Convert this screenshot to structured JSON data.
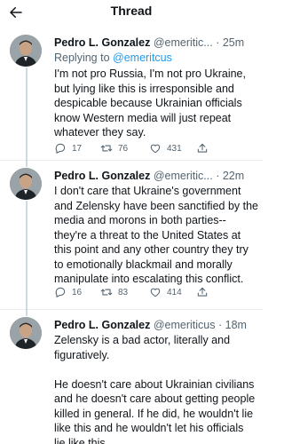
{
  "header": {
    "title": "Thread",
    "back_icon": "arrow-left-icon"
  },
  "colors": {
    "accent": "#1d9bf0",
    "secondary_text": "#536471",
    "divider": "#e6ecf0",
    "thread_line": "#cfd9de"
  },
  "tweets": [
    {
      "name": "Pedro L. Gonzalez",
      "handle": "@emeritic...",
      "time": "25m",
      "reply_prefix": "Replying to ",
      "reply_mention": "@emeritcus",
      "text": "I'm not pro Russia, I'm not pro Ukraine,\nbut lying like this is irresponsible and\ndespicable because Ukrainian officials\nknow Western media will just repeat\nwhatever they say.",
      "replies": "17",
      "retweets": "76",
      "likes": "431"
    },
    {
      "name": "Pedro L. Gonzalez",
      "handle": "@emeritic...",
      "time": "22m",
      "text": "I don't care that Ukraine's government\nand Zelensky have been sanctified by the\nmedia and morons in both parties--\nthey're a threat to the United States at\nthis point and any other country they try\nto emotionally blackmail and morally\nmanipulate into escalating this conflict.",
      "replies": "16",
      "retweets": "83",
      "likes": "414"
    },
    {
      "name": "Pedro L. Gonzalez",
      "handle": "@emeriticus",
      "time": "18m",
      "text": "Zelensky is a bad actor, literally and\nfiguratively.\n\nHe doesn't care about Ukrainian civilians\nand he doesn't care about getting people\nkilled in general. If he did, he wouldn't lie\nlike this and he wouldn't let his officials\nlie like this."
    }
  ]
}
